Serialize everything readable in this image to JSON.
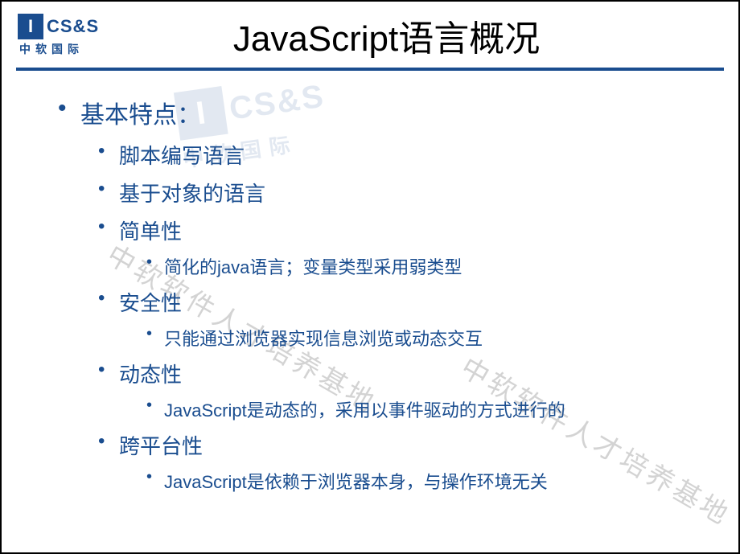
{
  "logo": {
    "mark": "I",
    "brand": "CS&S",
    "sub": "中软国际"
  },
  "title": "JavaScript语言概况",
  "content": {
    "heading": "基本特点：",
    "points": [
      {
        "text": "脚本编写语言",
        "children": []
      },
      {
        "text": "基于对象的语言",
        "children": []
      },
      {
        "text": "简单性",
        "children": [
          "简化的java语言；变量类型采用弱类型"
        ]
      },
      {
        "text": "安全性",
        "children": [
          "只能通过浏览器实现信息浏览或动态交互"
        ]
      },
      {
        "text": "动态性",
        "children": [
          "JavaScript是动态的，采用以事件驱动的方式进行的"
        ]
      },
      {
        "text": "跨平台性",
        "children": [
          "JavaScript是依赖于浏览器本身，与操作环境无关"
        ]
      }
    ]
  },
  "watermark": {
    "text": "中软软件人才培养基地"
  }
}
